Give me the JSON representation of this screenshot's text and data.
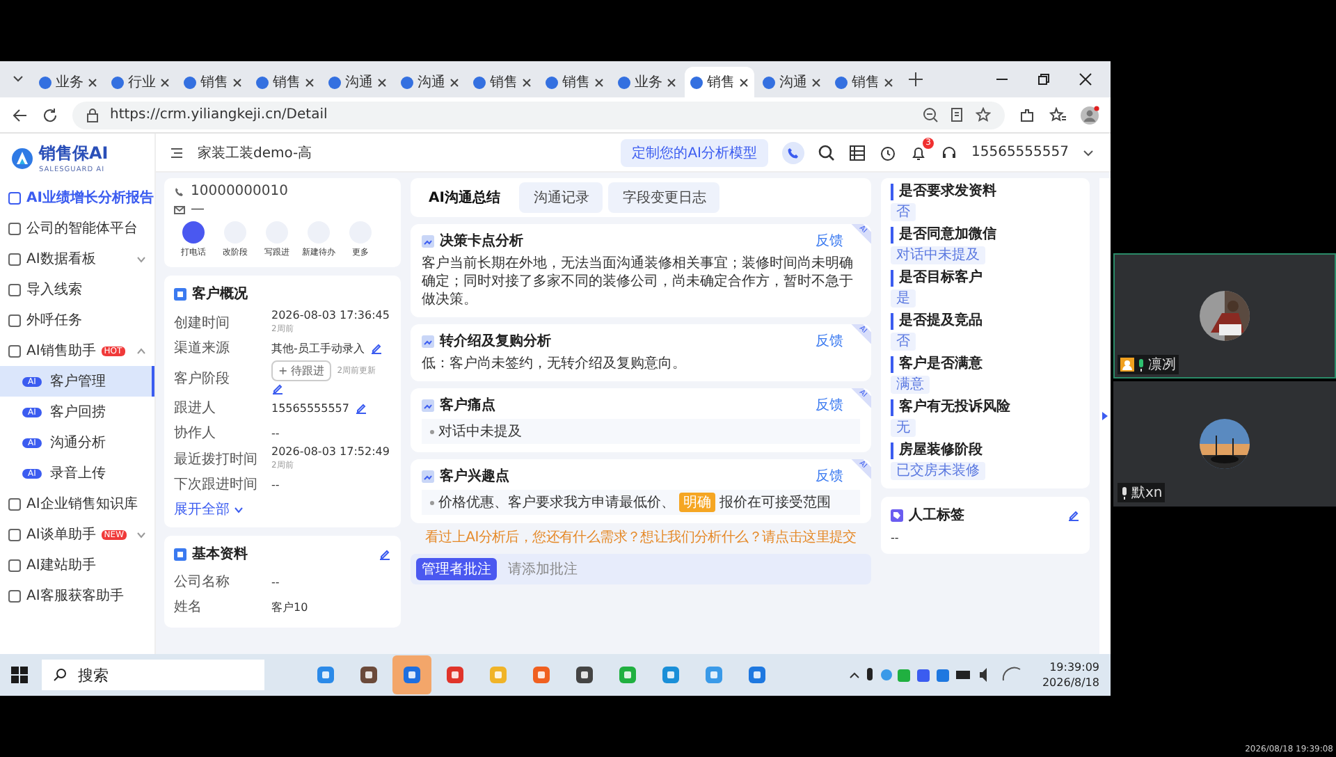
{
  "browser": {
    "tabs": [
      {
        "label": "业务",
        "selected": false
      },
      {
        "label": "行业",
        "selected": false
      },
      {
        "label": "销售",
        "selected": false
      },
      {
        "label": "销售",
        "selected": false
      },
      {
        "label": "沟通",
        "selected": false
      },
      {
        "label": "沟通",
        "selected": false
      },
      {
        "label": "销售",
        "selected": false
      },
      {
        "label": "销售",
        "selected": false
      },
      {
        "label": "业务",
        "selected": false
      },
      {
        "label": "销售",
        "selected": true
      },
      {
        "label": "沟通",
        "selected": false
      },
      {
        "label": "销售",
        "selected": false
      }
    ],
    "url": "https://crm.yiliangkeji.cn/Detail"
  },
  "sidebar": {
    "logo": {
      "name": "销售保AI",
      "subtitle": "SALESGUARD AI"
    },
    "items": [
      {
        "label": "AI业绩增长分析报告",
        "selected": true
      },
      {
        "label": "公司的智能体平台",
        "selected": false
      },
      {
        "label": "AI数据看板",
        "selected": false,
        "expanded": false
      },
      {
        "label": "导入线索",
        "selected": false
      },
      {
        "label": "外呼任务",
        "selected": false
      },
      {
        "label": "AI销售助手",
        "selected": false,
        "badge": "HOT",
        "expanded": true,
        "children": [
          {
            "chip": "AI",
            "label": "客户管理",
            "selected": true
          },
          {
            "chip": "AI",
            "label": "客户回捞",
            "selected": false
          },
          {
            "chip": "AI",
            "label": "沟通分析",
            "selected": false
          },
          {
            "chip": "AI",
            "label": "录音上传",
            "selected": false
          }
        ]
      },
      {
        "label": "AI企业销售知识库",
        "selected": false
      },
      {
        "label": "AI谈单助手",
        "selected": false,
        "badge": "NEW",
        "expanded": false
      },
      {
        "label": "AI建站助手",
        "selected": false
      },
      {
        "label": "AI客服获客助手",
        "selected": false
      }
    ]
  },
  "header": {
    "title": "家装工装demo-高",
    "model_button": "定制您的AI分析模型",
    "notifications": "3",
    "user": "15565555557"
  },
  "contact": {
    "phone": "10000000010",
    "email": "—",
    "actions": [
      "打电话",
      "改阶段",
      "写跟进",
      "新建待办",
      "更多"
    ]
  },
  "overview": {
    "title": "客户概况",
    "rows": [
      {
        "kind": "text",
        "label": "创建时间",
        "value": "2026-08-03 17:36:45",
        "note": "2周前",
        "editable": false
      },
      {
        "kind": "text",
        "label": "渠道来源",
        "value": "其他-员工手动录入",
        "editable": true
      },
      {
        "kind": "stage",
        "label": "客户阶段",
        "value": "+ 待跟进",
        "note": "2周前更新",
        "editable": true
      },
      {
        "kind": "text",
        "label": "跟进人",
        "value": "15565555557",
        "editable": true
      },
      {
        "kind": "text",
        "label": "协作人",
        "value": "--",
        "editable": false
      },
      {
        "kind": "text",
        "label": "最近拨打时间",
        "value": "2026-08-03 17:52:49",
        "note": "2周前",
        "editable": false
      },
      {
        "kind": "text",
        "label": "下次跟进时间",
        "value": "--",
        "editable": false
      }
    ],
    "expand": "展开全部"
  },
  "basic": {
    "title": "基本资料",
    "rows": [
      {
        "label": "公司名称",
        "value": "--"
      },
      {
        "label": "姓名",
        "value": "客户10"
      }
    ]
  },
  "detail_tabs": [
    {
      "label": "AI沟通总结",
      "selected": true
    },
    {
      "label": "沟通记录",
      "selected": false
    },
    {
      "label": "字段变更日志",
      "selected": false
    }
  ],
  "analysis": [
    {
      "kind": "text",
      "title": "决策卡点分析",
      "feedback": "反馈",
      "ribbon": "AI",
      "text": "客户当前长期在外地，无法当面沟通装修相关事宜；装修时间尚未明确确定；同时对接了多家不同的装修公司，尚未确定合作方，暂时不急于做决策。"
    },
    {
      "kind": "text",
      "title": "转介绍及复购分析",
      "feedback": "反馈",
      "ribbon": "AI",
      "text": "低：客户尚未签约，无转介绍及复购意向。"
    },
    {
      "kind": "bullets",
      "title": "客户痛点",
      "feedback": "反馈",
      "ribbon": "AI",
      "items": [
        {
          "text": "对话中未提及"
        }
      ]
    },
    {
      "kind": "bullets",
      "title": "客户兴趣点",
      "feedback": "反馈",
      "ribbon": "AI",
      "items": [
        {
          "text": "价格优惠、客户要求我方申请最低价、",
          "tag": "明确",
          "rest": "报价在可接受范围"
        }
      ]
    }
  ],
  "survey_link": "看过上AI分析后，您还有什么需求？想让我们分析什么？请点击这里提交",
  "comment": {
    "button": "管理者批注",
    "placeholder": "请添加批注"
  },
  "fields": [
    {
      "title": "是否要求发资料",
      "value": "否"
    },
    {
      "title": "是否同意加微信",
      "value": "对话中未提及"
    },
    {
      "title": "是否目标客户",
      "value": "是"
    },
    {
      "title": "是否提及竞品",
      "value": "否"
    },
    {
      "title": "客户是否满意",
      "value": "满意"
    },
    {
      "title": "客户有无投诉风险",
      "value": "无"
    },
    {
      "title": "房屋装修阶段",
      "value": "已交房未装修"
    }
  ],
  "manual_tags": {
    "title": "人工标签",
    "value": "--"
  },
  "taskbar": {
    "search": "搜索",
    "apps": [
      {
        "kind": "refresh",
        "selected": false
      },
      {
        "kind": "person",
        "selected": false
      },
      {
        "kind": "arrow",
        "selected": true
      },
      {
        "kind": "office",
        "selected": false
      },
      {
        "kind": "folder",
        "selected": false
      },
      {
        "kind": "input",
        "selected": false
      },
      {
        "kind": "calculator",
        "selected": false
      },
      {
        "kind": "chat",
        "selected": false
      },
      {
        "kind": "edge",
        "selected": false
      },
      {
        "kind": "cloud",
        "selected": false
      },
      {
        "kind": "docs",
        "selected": false
      }
    ],
    "time": "19:39:09",
    "date": "2026/8/18"
  },
  "participants": [
    {
      "name": "凛冽",
      "active": true,
      "host": true
    },
    {
      "name": "默xn",
      "active": false,
      "host": false
    }
  ],
  "recording_time": "2026/08/18 19:39:08"
}
